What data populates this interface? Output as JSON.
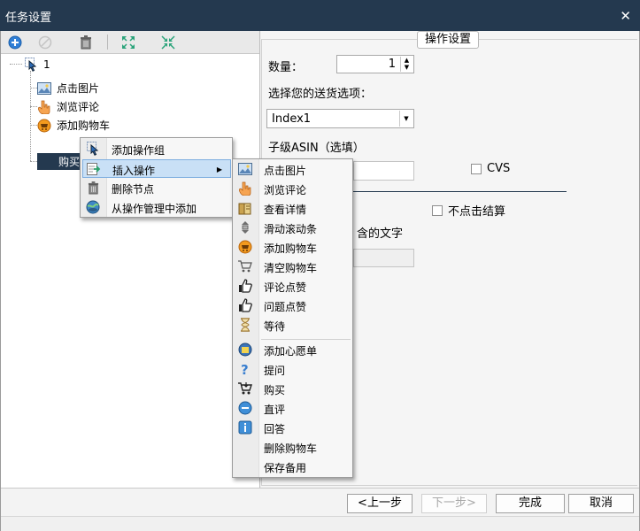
{
  "window": {
    "title": "任务设置",
    "close_icon": "close-icon"
  },
  "toolbar": {
    "add_icon": "add-circle-icon",
    "disable_icon": "disabled-circle-icon",
    "delete_icon": "trash-icon",
    "expand_icon": "expand-arrows-icon",
    "collapse_icon": "collapse-arrows-icon"
  },
  "tree": {
    "root_label": "1",
    "items": [
      {
        "label": "点击图片",
        "icon": "image-icon"
      },
      {
        "label": "浏览评论",
        "icon": "hand-pointer-icon"
      },
      {
        "label": "添加购物车",
        "icon": "cart-badge-icon"
      },
      {
        "label": "购买",
        "icon": "buy-icon"
      }
    ]
  },
  "settings": {
    "group_title": "操作设置",
    "quantity_label": "数量：",
    "quantity_value": "1",
    "shipping_label": "选择您的送货选项：",
    "shipping_value": "Index1",
    "asin_label": "子级ASIN（选填）",
    "cvs_label": "CVS",
    "no_checkout_label": "不点击结算",
    "text_label_partial": "含的文字"
  },
  "context_menu": {
    "items": [
      {
        "label": "添加操作组",
        "icon": "cursor-icon"
      },
      {
        "label": "插入操作",
        "icon": "insert-icon",
        "has_submenu": true
      },
      {
        "label": "删除节点",
        "icon": "trash-icon"
      },
      {
        "label": "从操作管理中添加",
        "icon": "globe-icon"
      }
    ]
  },
  "submenu": {
    "group1": [
      {
        "label": "点击图片",
        "icon": "image-icon"
      },
      {
        "label": "浏览评论",
        "icon": "hand-pointer-icon"
      },
      {
        "label": "查看详情",
        "icon": "book-icon"
      },
      {
        "label": "滑动滚动条",
        "icon": "scroll-icon"
      },
      {
        "label": "添加购物车",
        "icon": "cart-badge-icon"
      },
      {
        "label": "清空购物车",
        "icon": "empty-cart-icon"
      },
      {
        "label": "评论点赞",
        "icon": "thumbs-up-icon"
      },
      {
        "label": "问题点赞",
        "icon": "thumbs-up-icon"
      },
      {
        "label": "等待",
        "icon": "hourglass-icon"
      }
    ],
    "group2": [
      {
        "label": "添加心愿单",
        "icon": "wishlist-icon"
      },
      {
        "label": "提问",
        "icon": "question-icon"
      },
      {
        "label": "购买",
        "icon": "buy-cart-icon"
      },
      {
        "label": "直评",
        "icon": "comment-icon"
      },
      {
        "label": "回答",
        "icon": "info-icon"
      },
      {
        "label": "删除购物车",
        "icon": ""
      },
      {
        "label": "保存备用",
        "icon": ""
      }
    ]
  },
  "buttons": {
    "prev": "<上一步",
    "next": "下一步>",
    "finish": "完成",
    "cancel": "取消"
  }
}
